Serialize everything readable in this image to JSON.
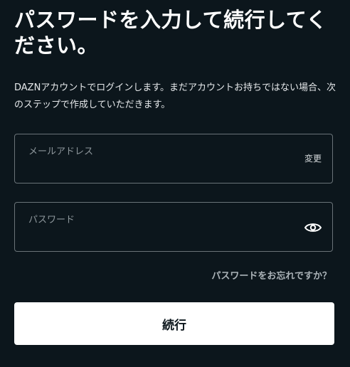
{
  "title": "パスワードを入力して続行してください。",
  "description": "DAZNアカウントでログインします。まだアカウントお持ちではない場合、次のステップで作成していただきます。",
  "email_field": {
    "label": "メールアドレス",
    "value": "",
    "change_label": "変更"
  },
  "password_field": {
    "label": "パスワード",
    "value": "",
    "toggle_icon": "eye-icon"
  },
  "forgot_password_label": "パスワードをお忘れですか？",
  "continue_label": "続行",
  "colors": {
    "background": "#0c161c",
    "field_border": "#6a7378",
    "button_bg": "#ffffff",
    "button_text": "#0c161c"
  }
}
